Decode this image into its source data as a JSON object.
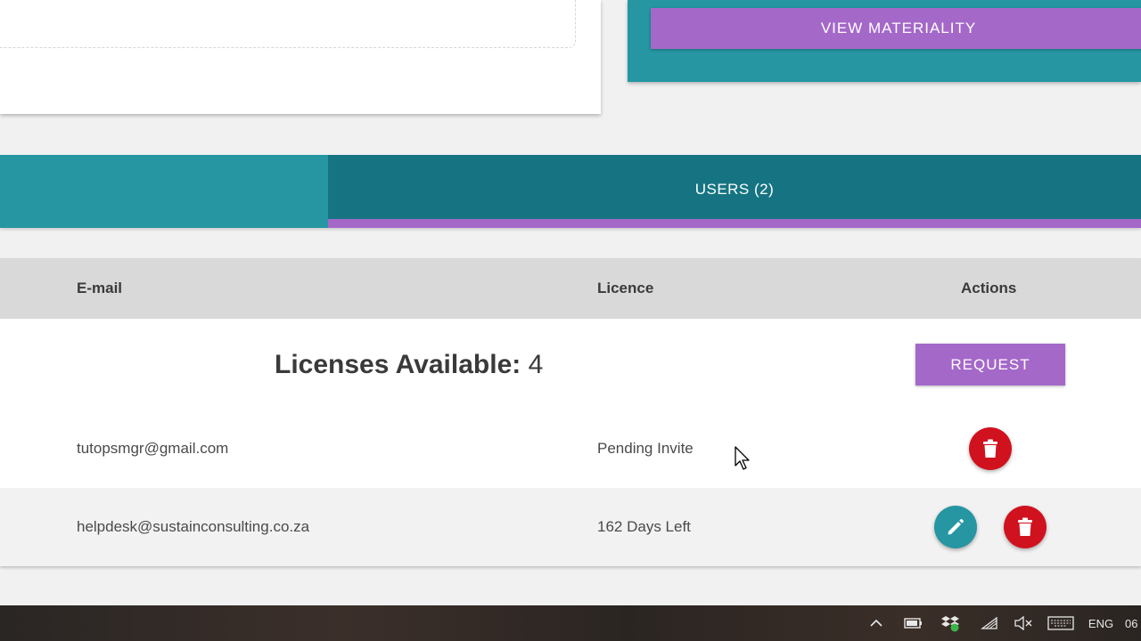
{
  "materiality": {
    "button_label": "VIEW MATERIALITY"
  },
  "tabs": {
    "active_label": "USERS (2)"
  },
  "table": {
    "headers": {
      "email": "E-mail",
      "licence": "Licence",
      "actions": "Actions"
    },
    "licenses_label": "Licenses Available:",
    "licenses_value": "4",
    "request_label": "REQUEST",
    "rows": [
      {
        "email": "tutopsmgr@gmail.com",
        "licence": "Pending Invite"
      },
      {
        "email": "helpdesk@sustainconsulting.co.za",
        "licence": "162 Days Left"
      }
    ]
  },
  "icons": {
    "delete": "trash-icon",
    "edit": "pencil-icon"
  },
  "colors": {
    "teal": "#2596a2",
    "teal_dark": "#167482",
    "purple": "#a468c9",
    "delete_red": "#d0121e"
  },
  "taskbar": {
    "lang": "ENG",
    "clock_partial": "06"
  }
}
